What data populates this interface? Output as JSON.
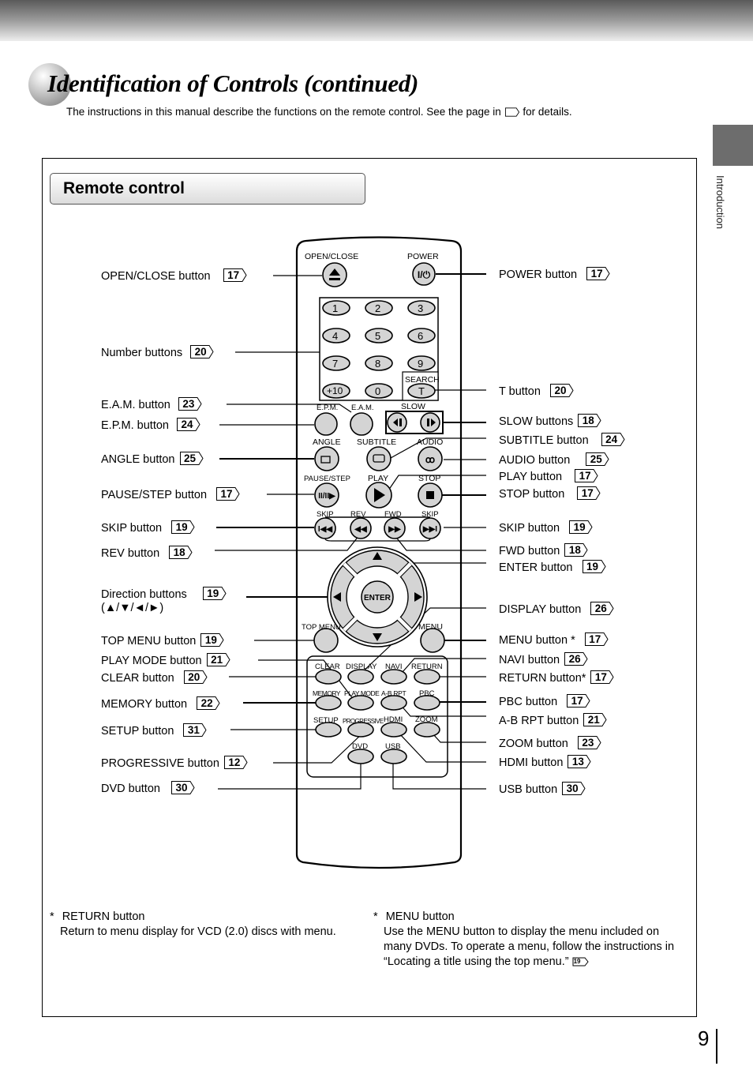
{
  "header": {
    "title": "Identification of Controls (continued)",
    "intro_before": "The instructions in this manual describe the functions on the remote control. See the page in",
    "intro_after": "for details.",
    "side_tab": "Introduction"
  },
  "section": {
    "title": "Remote control"
  },
  "remote": {
    "keys": {
      "open_close": "OPEN/CLOSE",
      "power": "POWER",
      "search": "SEARCH",
      "epm": "E.P.M.",
      "eam": "E.A.M.",
      "slow": "SLOW",
      "angle": "ANGLE",
      "subtitle": "SUBTITLE",
      "audio": "AUDIO",
      "pause_step": "PAUSE/STEP",
      "play": "PLAY",
      "stop": "STOP",
      "skip": "SKIP",
      "rev": "REV",
      "fwd": "FWD",
      "enter": "ENTER",
      "top_menu": "TOP MENU",
      "menu": "MENU",
      "clear": "CLEAR",
      "display": "DISPLAY",
      "navi": "NAVI",
      "return": "RETURN",
      "memory": "MEMORY",
      "play_mode": "PLAY MODE",
      "ab_rpt": "A-B RPT",
      "pbc": "PBC",
      "setup": "SETUP",
      "progressive": "PROGRESSIVE",
      "hdmi": "HDMI",
      "zoom": "ZOOM",
      "dvd": "DVD",
      "usb": "USB",
      "t": "T"
    },
    "numbers": [
      "1",
      "2",
      "3",
      "4",
      "5",
      "6",
      "7",
      "8",
      "9",
      "+10",
      "0"
    ]
  },
  "left_labels": [
    {
      "text": "OPEN/CLOSE button",
      "page": "17"
    },
    {
      "text": "Number buttons",
      "page": "20"
    },
    {
      "text": "E.A.M. button",
      "page": "23"
    },
    {
      "text": "E.P.M. button",
      "page": "24"
    },
    {
      "text": "ANGLE button",
      "page": "25"
    },
    {
      "text": "PAUSE/STEP button",
      "page": "17"
    },
    {
      "text": "SKIP button",
      "page": "19"
    },
    {
      "text": "REV button",
      "page": "18"
    },
    {
      "text": "Direction buttons",
      "page": "19",
      "sub": "(▲/▼/◄/►)"
    },
    {
      "text": "TOP MENU button",
      "page": "19"
    },
    {
      "text": "PLAY MODE button",
      "page": "21"
    },
    {
      "text": "CLEAR button",
      "page": "20"
    },
    {
      "text": "MEMORY button",
      "page": "22"
    },
    {
      "text": "SETUP button",
      "page": "31"
    },
    {
      "text": "PROGRESSIVE button",
      "page": "12"
    },
    {
      "text": "DVD button",
      "page": "30"
    }
  ],
  "right_labels": [
    {
      "text": "POWER button",
      "page": "17"
    },
    {
      "text": "T button",
      "page": "20"
    },
    {
      "text": "SLOW buttons",
      "page": "18"
    },
    {
      "text": "SUBTITLE button",
      "page": "24"
    },
    {
      "text": "AUDIO button",
      "page": "25"
    },
    {
      "text": "PLAY button",
      "page": "17"
    },
    {
      "text": "STOP button",
      "page": "17"
    },
    {
      "text": "SKIP button",
      "page": "19"
    },
    {
      "text": "FWD button",
      "page": "18"
    },
    {
      "text": "ENTER button",
      "page": "19"
    },
    {
      "text": "DISPLAY button",
      "page": "26"
    },
    {
      "text": "MENU button *",
      "page": "17"
    },
    {
      "text": "NAVI button",
      "page": "26"
    },
    {
      "text": "RETURN button*",
      "page": "17"
    },
    {
      "text": "PBC button",
      "page": "17"
    },
    {
      "text": "A-B RPT button",
      "page": "21"
    },
    {
      "text": "ZOOM button",
      "page": "23"
    },
    {
      "text": "HDMI button",
      "page": "13"
    },
    {
      "text": "USB button",
      "page": "30"
    }
  ],
  "notes": {
    "return": {
      "star": "*",
      "title": "RETURN button",
      "body": "Return to menu display for VCD (2.0) discs with menu."
    },
    "menu": {
      "star": "*",
      "title": "MENU button",
      "body": "Use the MENU button to display the menu included on many DVDs. To operate a menu, follow the instructions in “Locating a title using the top menu.”",
      "page": "19"
    }
  },
  "page_number": "9"
}
